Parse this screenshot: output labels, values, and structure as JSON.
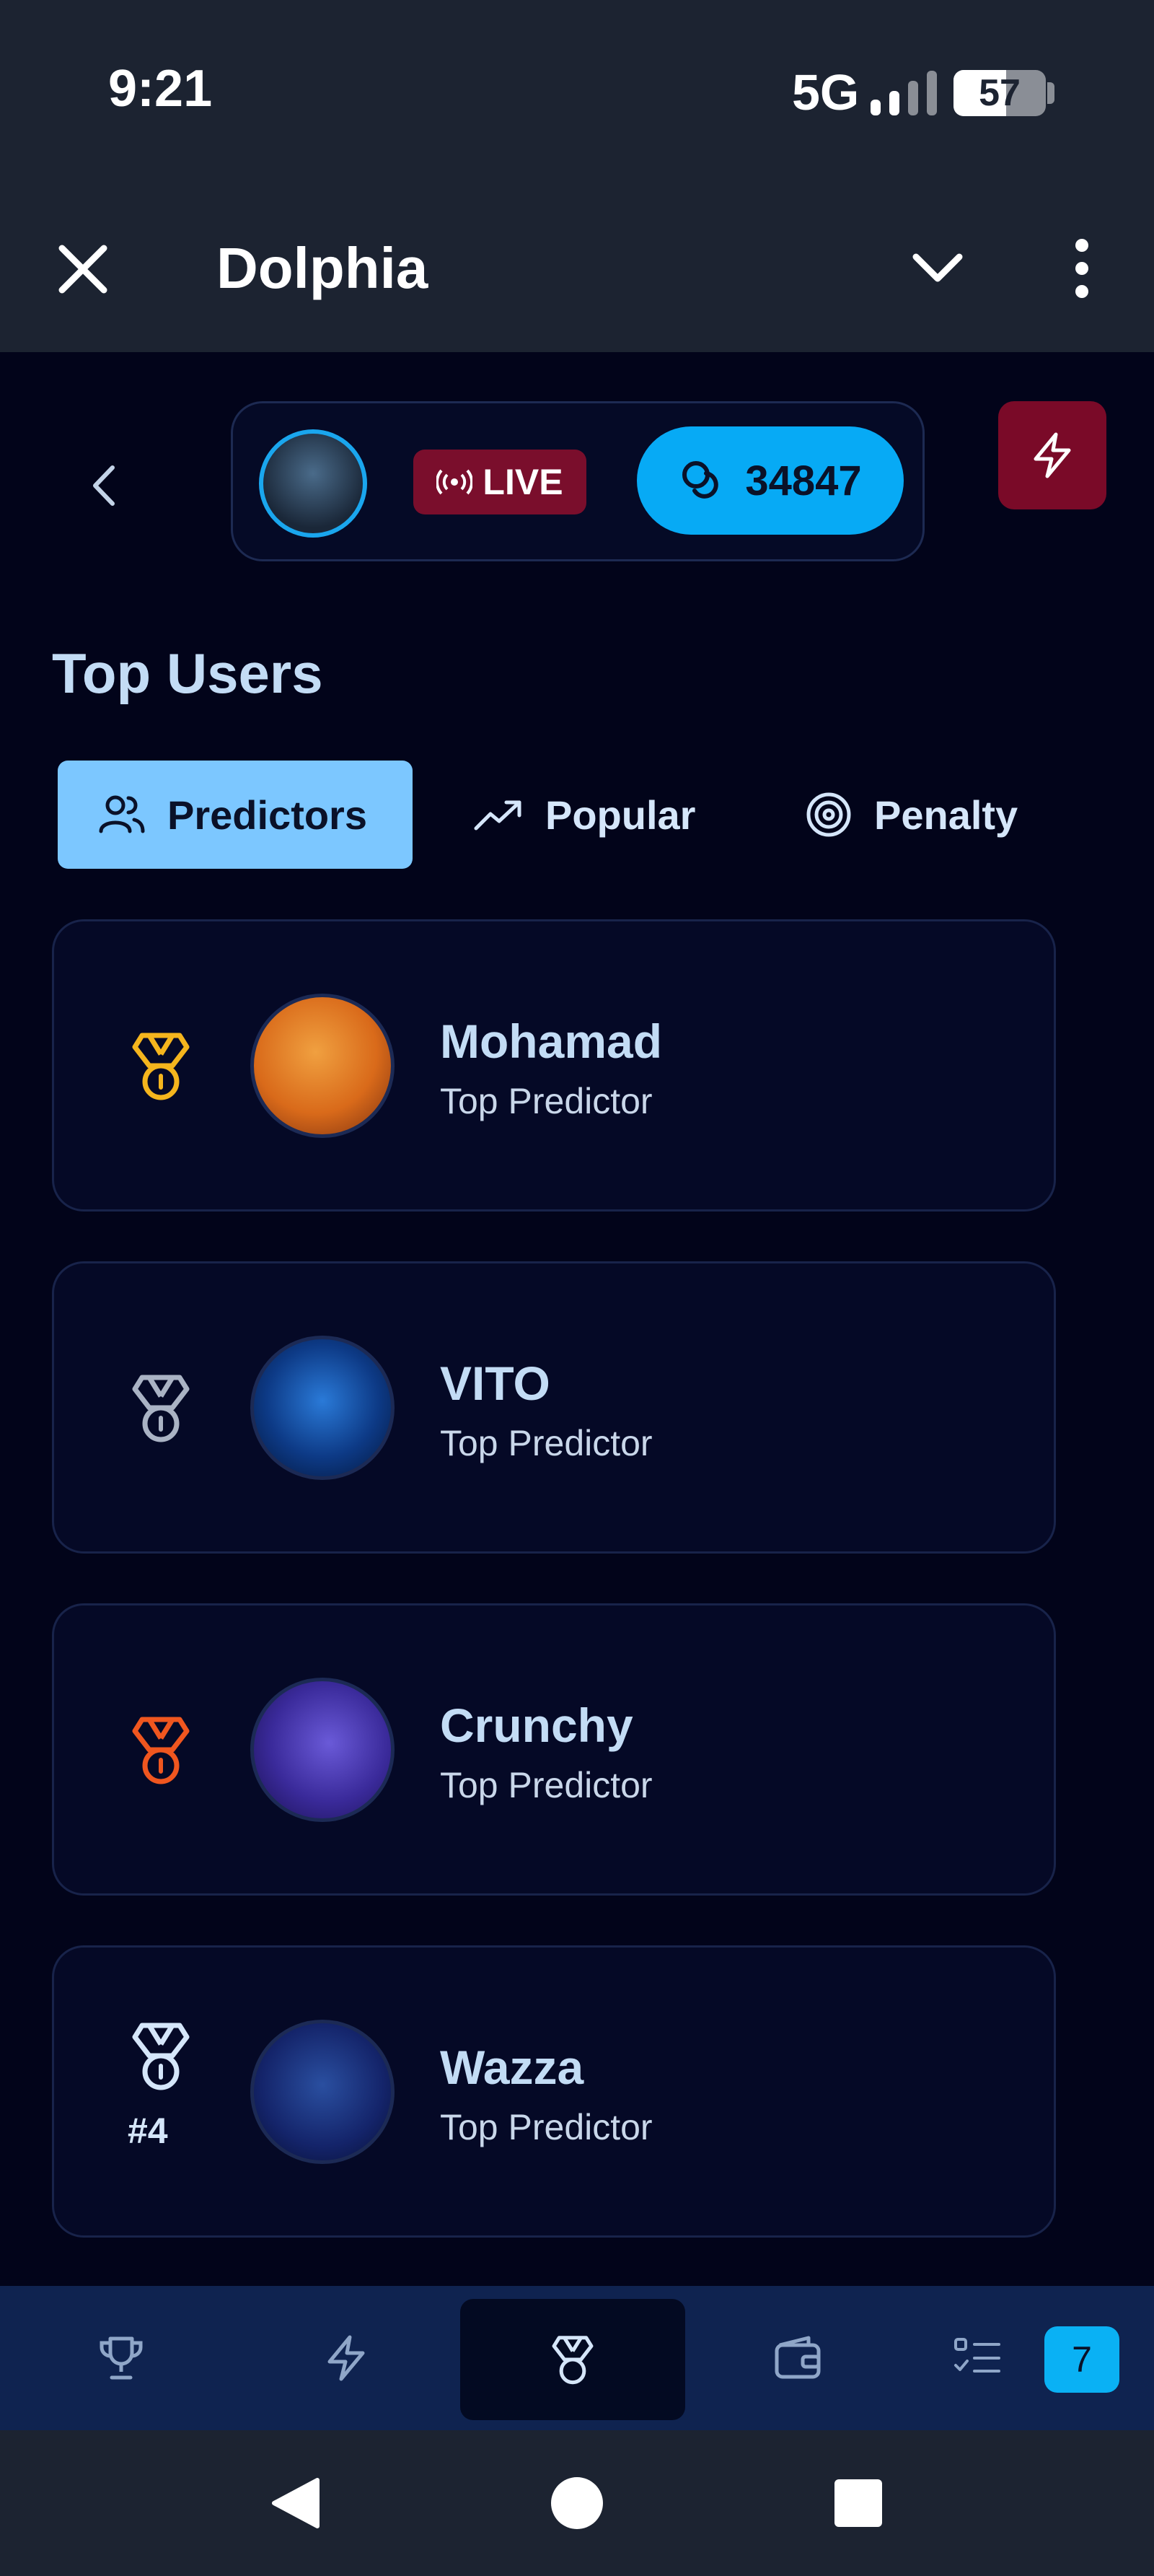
{
  "status": {
    "time": "9:21",
    "network": "5G",
    "battery": "57",
    "battery_level": 0.57
  },
  "app_bar": {
    "title": "Dolphia"
  },
  "header": {
    "live_label": "LIVE",
    "coins": "34847"
  },
  "section": {
    "title": "Top Users"
  },
  "tabs": [
    {
      "label": "Predictors",
      "icon": "users-icon",
      "active": true
    },
    {
      "label": "Popular",
      "icon": "trending-up-icon",
      "active": false
    },
    {
      "label": "Penalty",
      "icon": "target-icon",
      "active": false
    }
  ],
  "users": [
    {
      "name": "Mohamad",
      "role": "Top Predictor",
      "medal": "gold-medal-icon",
      "medal_color": "#f5b51d"
    },
    {
      "name": "VITO",
      "role": "Top Predictor",
      "medal": "silver-medal-icon",
      "medal_color": "#aab3c4"
    },
    {
      "name": "Crunchy",
      "role": "Top Predictor",
      "medal": "bronze-medal-icon",
      "medal_color": "#f0561f"
    },
    {
      "name": "Wazza",
      "role": "Top Predictor",
      "medal": "medal-icon",
      "medal_color": "#d5e6fa",
      "rank": "#4"
    }
  ],
  "bottom_nav": {
    "items": [
      "trophy-icon",
      "bolt-icon",
      "medal-icon",
      "wallet-icon",
      "task-list-icon"
    ],
    "active": "medal-icon",
    "badge": "7"
  },
  "colors": {
    "background": "#02041a",
    "app_bar": "#1c2331",
    "accent": "#07aaf5",
    "tab_active": "#7cc7ff",
    "live": "#7a0e2c"
  }
}
